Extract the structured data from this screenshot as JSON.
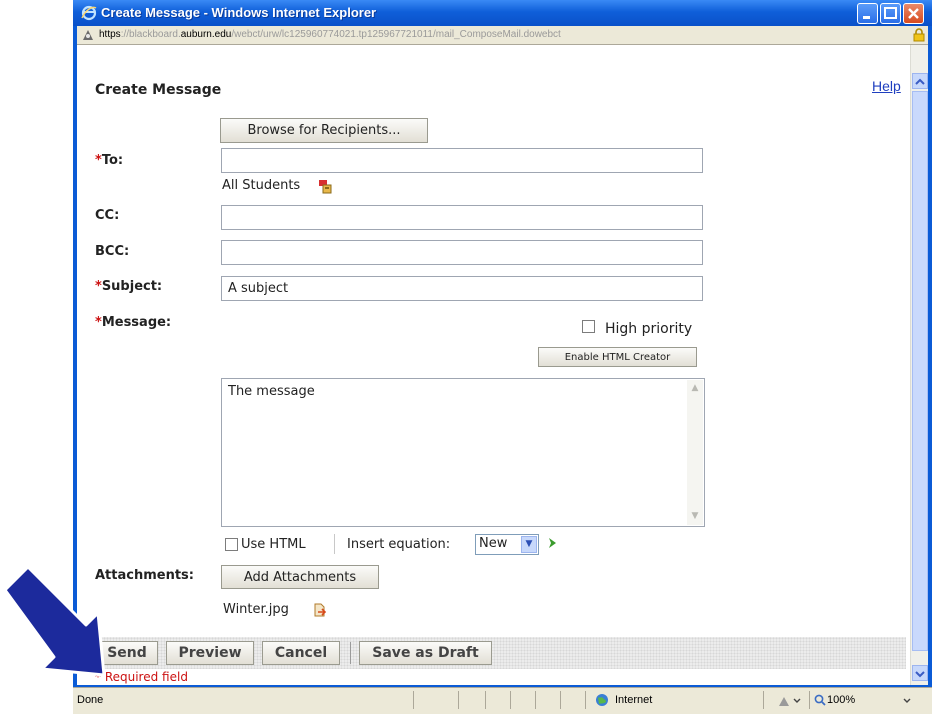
{
  "window": {
    "title": "Create Message - Windows Internet Explorer",
    "url_scheme": "https",
    "url_dim_1": "://blackboard.",
    "url_host": "auburn.edu",
    "url_dim_2": "/webct/urw/lc125960774021.tp125967721011/mail_ComposeMail.dowebct"
  },
  "form": {
    "title": "Create Message",
    "help": "Help",
    "browse_button": "Browse for Recipients...",
    "required_marker": "*",
    "to_label": "To:",
    "to_value": "",
    "recipients_note": "All Students",
    "cc_label": "CC:",
    "cc_value": "",
    "bcc_label": "BCC:",
    "bcc_value": "",
    "subject_label": "Subject:",
    "subject_value": "A subject",
    "message_label": "Message:",
    "high_priority": "High priority",
    "html_creator_button": "Enable HTML Creator",
    "message_body": "The message",
    "use_html": "Use HTML",
    "insert_equation": "Insert equation:",
    "equation_value": "New",
    "attachments_label": "Attachments:",
    "add_attachments_button": "Add Attachments",
    "attachment_file": "Winter.jpg",
    "required_note": "* Required field"
  },
  "actions": {
    "send": "Send",
    "preview": "Preview",
    "cancel": "Cancel",
    "save_draft": "Save as Draft"
  },
  "status": {
    "text": "Done",
    "zone": "Internet",
    "zoom": "100%"
  },
  "colors": {
    "titlebar": "#0f5fd9",
    "required": "#cc1111",
    "pointer_arrow": "#1c2a9c"
  }
}
